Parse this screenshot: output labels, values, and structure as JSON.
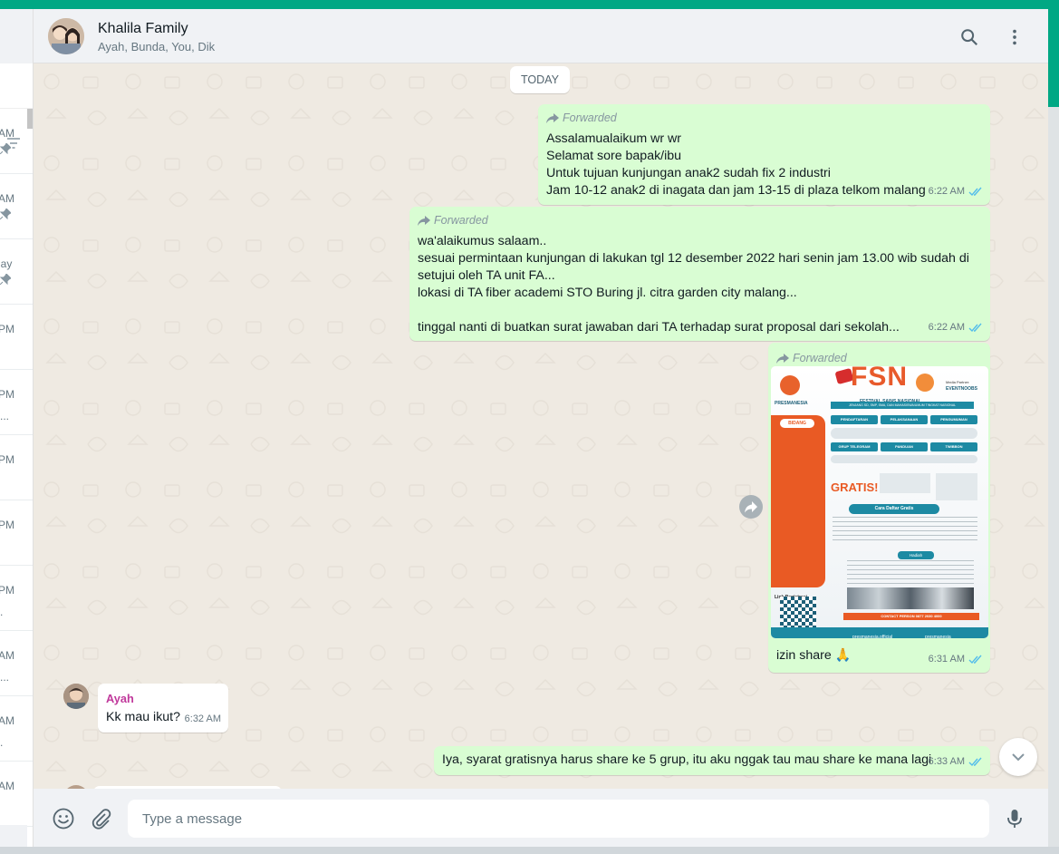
{
  "sidebar": {
    "items": [
      {
        "time": "AM",
        "pinned": true,
        "sub": ""
      },
      {
        "time": "AM",
        "pinned": true,
        "sub": ""
      },
      {
        "time": "lay",
        "pinned": true,
        "sub": ""
      },
      {
        "time": "PM",
        "pinned": false,
        "sub": ""
      },
      {
        "time": "PM",
        "pinned": false,
        "sub": "..."
      },
      {
        "time": "PM",
        "pinned": false,
        "sub": ""
      },
      {
        "time": "PM",
        "pinned": false,
        "sub": ""
      },
      {
        "time": "PM",
        "pinned": false,
        "sub": "."
      },
      {
        "time": "AM",
        "pinned": false,
        "sub": "..."
      },
      {
        "time": "AM",
        "pinned": false,
        "sub": "."
      },
      {
        "time": "AM",
        "pinned": false,
        "sub": ""
      }
    ]
  },
  "header": {
    "title": "Khalila Family",
    "members": "Ayah, Bunda, You, Dik"
  },
  "chat": {
    "day_label": "TODAY",
    "forwarded_label": "Forwarded",
    "messages": [
      {
        "lines": [
          "Assalamualaikum wr wr",
          "Selamat sore bapak/ibu",
          "Untuk tujuan kunjungan anak2 sudah fix 2 industri",
          "Jam 10-12 anak2 di inagata dan jam 13-15 di plaza telkom malang"
        ],
        "time": "6:22 AM"
      },
      {
        "lines": [
          "wa'alaikumus salaam..",
          "sesuai permintaan kunjungan di lakukan tgl 12 desember 2022 hari senin jam 13.00 wib sudah di",
          "setujui oleh TA unit FA...",
          "lokasi di TA fiber academi STO Buring jl. citra garden city malang...",
          "",
          "tinggal nanti di buatkan surat jawaban dari TA terhadap surat proposal dari sekolah..."
        ],
        "time": "6:22 AM"
      },
      {
        "caption": "izin share 🙏",
        "time": "6:31 AM",
        "poster": {
          "org": "PRESMANESIA",
          "big": "FSN",
          "subtitle": "FESTIVAL SAINS NASIONAL",
          "partner": "Media Partner:",
          "partner_name": "EVENTNOOBS",
          "level": "JENJANG SD, SMP, SMA, DAN MAHASISWA/UMUM TINGKAT NASIONAL",
          "bidang": "BIDANG",
          "pendaftaran": "PENDAFTARAN",
          "pelaksanaan": "PELAKSANAAN",
          "pengumuman": "PENGUMUMAN",
          "grup": "GRUP TELEGRAM",
          "panduan": "PANDUAN",
          "twibbon": "TWIBBON",
          "gratis": "GRATIS!",
          "cara": "Cara Daftar Gratis",
          "hadiah": "Hadiah",
          "link": "Link Registrasi",
          "contact": "CONTACT PERSON 0877 2030 4000",
          "social1": "presmanesia.official",
          "social2": "presmanesia"
        }
      },
      {
        "sender": "Ayah",
        "text": "Kk mau ikut?",
        "time": "6:32 AM"
      },
      {
        "text": "Iya, syarat gratisnya harus share ke 5 grup, itu aku nggak tau mau share ke mana lagi",
        "time": "6:33 AM"
      }
    ]
  },
  "composer": {
    "placeholder": "Type a message"
  }
}
